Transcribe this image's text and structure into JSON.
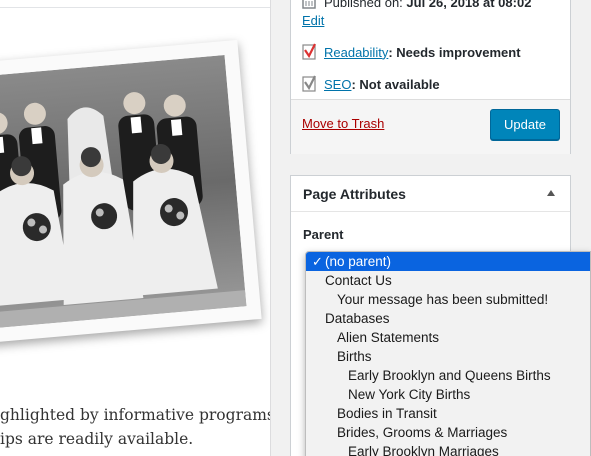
{
  "editor": {
    "text_lines": [
      "ghlighted by informative programs",
      "ips are readily available."
    ]
  },
  "publish": {
    "published_prefix": "Published on:",
    "published_date": "Jul 26, 2018 at 08:02",
    "edit_label": "Edit",
    "readability_link": "Readability",
    "readability_status": ": Needs improvement",
    "seo_link": "SEO",
    "seo_status": ": Not available",
    "trash_label": "Move to Trash",
    "update_label": "Update",
    "colors": {
      "primary": "#0085ba",
      "trash": "#aa0000",
      "readability_icon": "#dc3232"
    }
  },
  "page_attributes": {
    "title": "Page Attributes",
    "parent_label": "Parent",
    "options": [
      {
        "label": "(no parent)",
        "level": 0,
        "selected": true
      },
      {
        "label": "Contact Us",
        "level": 0,
        "selected": false
      },
      {
        "label": "Your message has been submitted!",
        "level": 1,
        "selected": false
      },
      {
        "label": "Databases",
        "level": 0,
        "selected": false
      },
      {
        "label": "Alien Statements",
        "level": 1,
        "selected": false
      },
      {
        "label": "Births",
        "level": 1,
        "selected": false
      },
      {
        "label": "Early Brooklyn and Queens Births",
        "level": 2,
        "selected": false
      },
      {
        "label": "New York City Births",
        "level": 2,
        "selected": false
      },
      {
        "label": "Bodies in Transit",
        "level": 1,
        "selected": false
      },
      {
        "label": "Brides, Grooms & Marriages",
        "level": 1,
        "selected": false
      },
      {
        "label": "Early Brooklyn Marriages",
        "level": 2,
        "selected": false
      }
    ]
  }
}
